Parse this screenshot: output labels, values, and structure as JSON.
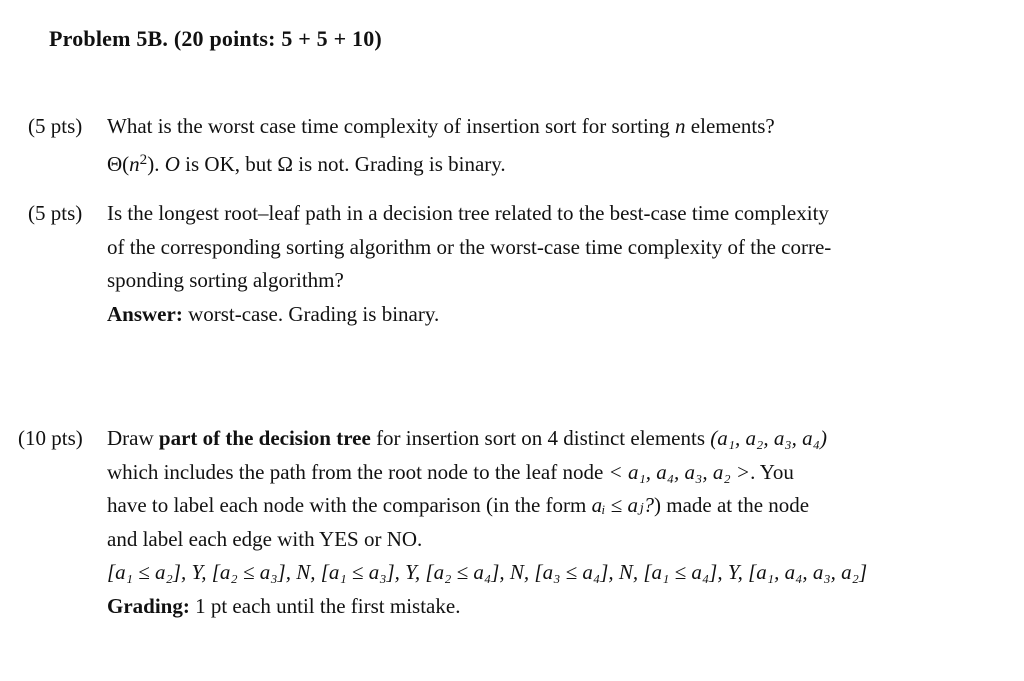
{
  "title": "Problem 5B. (20 points: 5 + 5 + 10)",
  "parts": [
    {
      "points": "(5 pts)",
      "question": "What is the worst case time complexity of insertion sort for sorting n elements?",
      "question_pre": "What is the worst case time complexity of insertion sort for sorting ",
      "question_var": "n",
      "question_post": " elements?",
      "answer_theta": "Θ(",
      "answer_n": "n",
      "answer_exp": "2",
      "answer_close": ").",
      "answer_O": "O",
      "answer_rest1": " is OK, but ",
      "answer_omega": "Ω",
      "answer_rest2": " is not. Grading is binary."
    },
    {
      "points": "(5 pts)",
      "lines": [
        "Is the longest root–leaf path in a decision tree related to the best-case time complexity",
        "of the corresponding sorting algorithm or the worst-case time complexity of the corre-",
        "sponding sorting algorithm?"
      ],
      "answer_label": "Answer:",
      "answer_text": " worst-case. Grading is binary."
    },
    {
      "points": "(10 pts)",
      "line1_pre": "Draw ",
      "line1_bold": "part of the decision tree",
      "line1_post": " for insertion sort on 4 distinct elements ",
      "line1_math": "(a₁, a₂, a₃, a₄)",
      "line2_pre": "which includes the path from the root node to the leaf node ",
      "line2_math": "< a₁, a₄, a₃, a₂ >",
      "line2_post": ".  You",
      "line3_pre": "have to label each node with the comparison (in the form ",
      "line3_math": "aᵢ ≤ aⱼ?",
      "line3_post": ") made at the node",
      "line4": "and label each edge with YES or NO.",
      "solution": "[a₁ ≤ a₂], Y, [a₂ ≤ a₃], N, [a₁ ≤ a₃], Y, [a₂ ≤ a₄], N, [a₃ ≤ a₄], N, [a₁ ≤ a₄], Y, [a₁, a₄, a₃, a₂]",
      "grading_label": "Grading:",
      "grading_text": " 1 pt each until the first mistake."
    }
  ]
}
